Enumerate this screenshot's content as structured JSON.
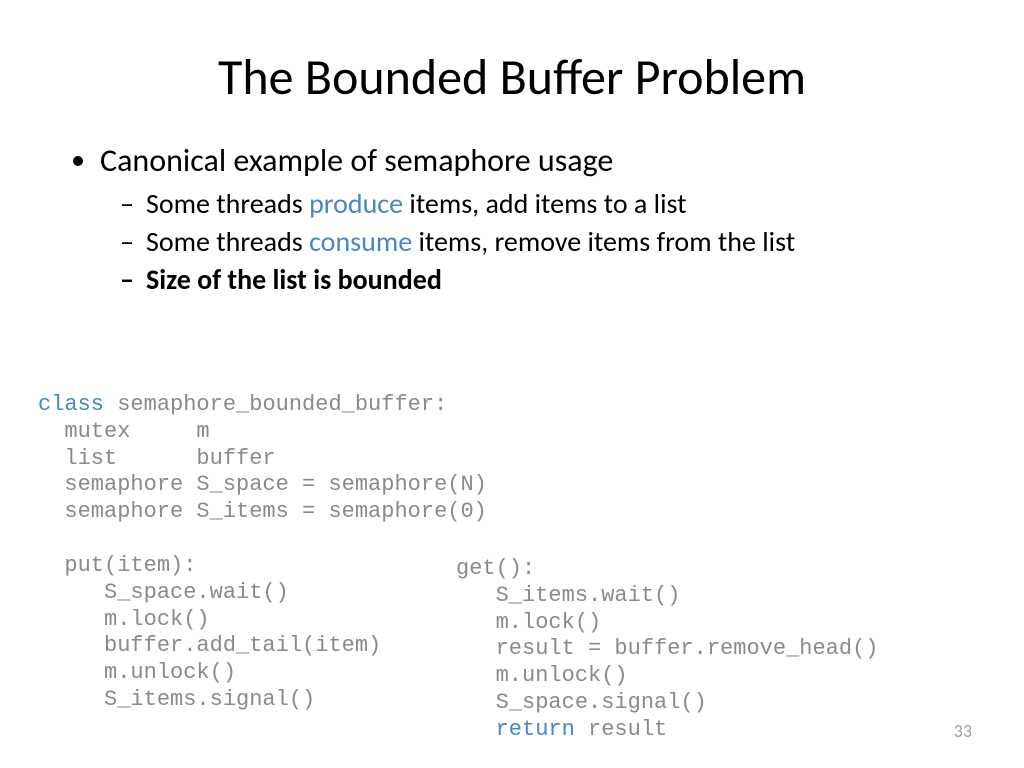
{
  "title": "The Bounded Buffer Problem",
  "bullet_main": "Canonical example of semaphore usage",
  "sub": {
    "a_pre": "Some threads ",
    "a_kw": "produce",
    "a_post": " items, add items to a list",
    "b_pre": "Some threads ",
    "b_kw": "consume",
    "b_post": " items, remove items from the list",
    "c": "Size of the list is bounded"
  },
  "code": {
    "kw_class": "class",
    "kw_return": "return",
    "left_after_class": " semaphore_bounded_buffer:\n  mutex     m\n  list      buffer\n  semaphore S_space = semaphore(N)\n  semaphore S_items = semaphore(0)\n\n  put(item):\n     S_space.wait()\n     m.lock()\n     buffer.add_tail(item)\n     m.unlock()\n     S_items.signal()",
    "right_before_return": "get():\n   S_items.wait()\n   m.lock()\n   result = buffer.remove_head()\n   m.unlock()\n   S_space.signal()\n   ",
    "right_after_return": " result"
  },
  "page_number": "33"
}
